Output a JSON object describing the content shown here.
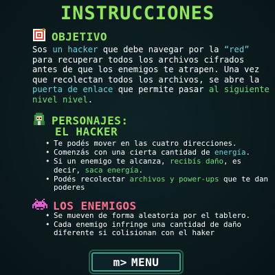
{
  "title": "INSTRUCCIONES",
  "objective": {
    "heading": "OBJETIVO",
    "icon": "target-icon",
    "p1": "Sos ",
    "h1": "un hacker",
    "p2": " que debe navegar por la ",
    "h2": "“red”",
    "p3": " para recuperar todos los archivos cifrados antes de que los enemigos te atrapen. Una vez que recolectan todos los archivos, se abre la ",
    "h3": "puerta de enlace",
    "p4": " que permite pasar ",
    "h4": "al siguiente nivel nivel",
    "p5": "."
  },
  "characters": {
    "heading": "PERSONAJES:",
    "icon": "hacker-icon",
    "hacker": {
      "heading": "EL HACKER",
      "b1": "Te podés mover en las cuatro direcciones.",
      "b2a": "Comenzás con una cierta cantidad de ",
      "b2h": "energía",
      "b2b": ".",
      "b3a": "Si un enemigo te alcanza, ",
      "b3h1": "recibís daño",
      "b3b": ", es decir, ",
      "b3h2": "saca energía",
      "b3c": ".",
      "b4a": "Podés recolectar ",
      "b4h": "archivos y power-ups",
      "b4b": " que te dan poderes"
    }
  },
  "enemies": {
    "heading": "LOS ENEMIGOS",
    "icon": "space-invader-icon",
    "b1": "Se mueven de forma aleatoria por el tablero.",
    "b2": "Cada enemigo infringe una cantidad de daño diferente si colisionan con el haker"
  },
  "menu_button": {
    "key": "m>",
    "label": "MENU"
  },
  "colors": {
    "title": "#8ee65a",
    "highlight_green": "#6ce07a",
    "highlight_cyan": "#67d4d6",
    "enemies_heading": "#ff6f8f",
    "background": "#0b1a1d"
  }
}
